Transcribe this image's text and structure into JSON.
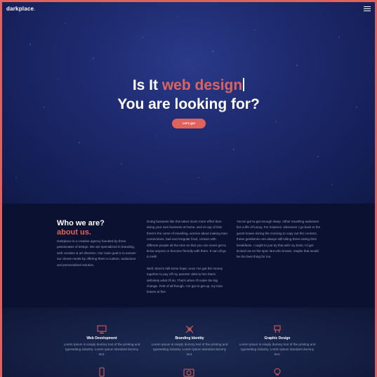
{
  "brand": {
    "name": "darkplace",
    "dot": "."
  },
  "hero": {
    "line1_prefix": "Is It ",
    "line1_accent": "web design",
    "line2": "You are looking for?",
    "cta_label": "Let's go!"
  },
  "about": {
    "title": "Who we are?",
    "title_accent": "about us.",
    "intro": "Darkplace is a creative agency founded by three passionates of design. We are specialized in branding, web creation & art direction. Our main goal is to answer our clients needs by offering them a custom, audacious and personalized solution.",
    "col2_p1": "Doing business like this takes much more effort than doing your own business at home, and on top of that there's the curse of travelling, worries about making train connections, bad and irregular food, contact with different people all the time so that you can never get to know anyone or become friendly with them. It can all go to Hell!",
    "col2_p2": "Well, there's still some hope; once I've got the money together to pay off my parents' debt to him that's definitely what I'll do. That's when I'll make the big change. First of all though, I've got to get up, my train leaves at five.",
    "col3_p1": "You've got to get enough sleep. Other travelling salesmen live a life of luxury. For instance, whenever I go back to the guest house during the morning to copy out the contract, these gentlemen are always still sitting there eating their breakfasts. I ought to just try that with my boss; I'd get kicked out on the spot. But who knows, maybe that would be the best thing for me."
  },
  "services": [
    {
      "icon": "monitor-icon",
      "title": "Web Development",
      "text": "Lorem Ipsum is simply dummy text of the printing and typesetting industry. Lorem Ipsum standard dummy text."
    },
    {
      "icon": "pencil-ruler-icon",
      "title": "Branding Identity",
      "text": "Lorem Ipsum is simply dummy text of the printing and typesetting industry. Lorem Ipsum standard dummy text."
    },
    {
      "icon": "easel-icon",
      "title": "Graphic Design",
      "text": "Lorem Ipsum is simply dummy text of the printing and typesetting industry. Lorem Ipsum standard dummy text."
    }
  ],
  "services_row2": [
    {
      "icon": "mobile-icon"
    },
    {
      "icon": "camera-icon"
    },
    {
      "icon": "lightbulb-icon"
    }
  ],
  "colors": {
    "accent": "#e0625e",
    "hero_bg": "#1e2a6e",
    "about_bg": "#0b1130"
  }
}
